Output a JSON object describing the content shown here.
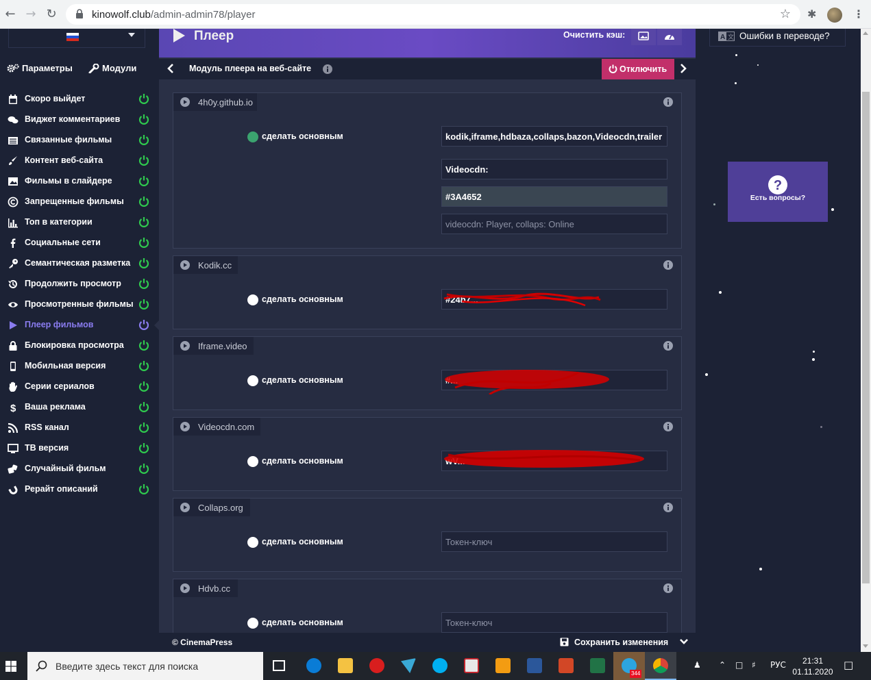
{
  "browser": {
    "url_host": "kinowolf.club",
    "url_path": "/admin-admin78/player"
  },
  "sidebar": {
    "tabs": [
      {
        "label": "Параметры"
      },
      {
        "label": "Модули"
      }
    ],
    "items": [
      {
        "label": "Скоро выйдет",
        "icon": "calendar-icon"
      },
      {
        "label": "Виджет комментариев",
        "icon": "comments-icon"
      },
      {
        "label": "Связанные фильмы",
        "icon": "list-icon"
      },
      {
        "label": "Контент веб-сайта",
        "icon": "brush-icon"
      },
      {
        "label": "Фильмы в слайдере",
        "icon": "images-icon"
      },
      {
        "label": "Запрещенные фильмы",
        "icon": "copyright-icon"
      },
      {
        "label": "Топ в категории",
        "icon": "chart-icon"
      },
      {
        "label": "Социальные сети",
        "icon": "facebook-icon"
      },
      {
        "label": "Семантическая разметка",
        "icon": "key-icon"
      },
      {
        "label": "Продолжить просмотр",
        "icon": "history-icon"
      },
      {
        "label": "Просмотренные фильмы",
        "icon": "eye-icon"
      },
      {
        "label": "Плеер фильмов",
        "icon": "play-icon",
        "active": true
      },
      {
        "label": "Блокировка просмотра",
        "icon": "lock-icon"
      },
      {
        "label": "Мобильная версия",
        "icon": "mobile-icon"
      },
      {
        "label": "Серии сериалов",
        "icon": "hand-icon"
      },
      {
        "label": "Ваша реклама",
        "icon": "dollar-icon"
      },
      {
        "label": "RSS канал",
        "icon": "rss-icon"
      },
      {
        "label": "ТВ версия",
        "icon": "tv-icon"
      },
      {
        "label": "Случайный фильм",
        "icon": "dice-icon"
      },
      {
        "label": "Рерайт описаний",
        "icon": "magnet-icon"
      }
    ]
  },
  "header": {
    "title": "Плеер",
    "cache_label": "Очистить кэш:"
  },
  "subbar": {
    "label": "Модуль плеера на веб-сайте",
    "disable_label": "Отключить"
  },
  "panels": [
    {
      "tab": "4h0y.github.io",
      "radio_label": "сделать основным",
      "selected": true,
      "fields": [
        {
          "value": "kodik,iframe,hdbaza,collaps,bazon,Videocdn,trailer",
          "style": "bold"
        },
        {
          "value": " Videocdn:",
          "style": "bold"
        },
        {
          "value": "#3A4652",
          "style": "light"
        },
        {
          "value": "videocdn: Player, collaps: Online",
          "style": "ph"
        }
      ]
    },
    {
      "tab": "Kodik.cc",
      "radio_label": "сделать основным",
      "selected": false,
      "fields": [
        {
          "value": "#24b7...",
          "style": "redacted"
        }
      ]
    },
    {
      "tab": "Iframe.video",
      "radio_label": "сделать основным",
      "selected": false,
      "fields": [
        {
          "value": "#...",
          "style": "redacted"
        }
      ]
    },
    {
      "tab": "Videocdn.com",
      "radio_label": "сделать основным",
      "selected": false,
      "fields": [
        {
          "value": "wV...",
          "style": "redacted"
        }
      ]
    },
    {
      "tab": "Collaps.org",
      "radio_label": "сделать основным",
      "selected": false,
      "fields": [
        {
          "placeholder": "Токен-ключ",
          "style": "ph"
        }
      ]
    },
    {
      "tab": "Hdvb.cc",
      "radio_label": "сделать основным",
      "selected": false,
      "fields": [
        {
          "placeholder": "Токен-ключ",
          "style": "ph"
        }
      ]
    }
  ],
  "footer": {
    "copyright": "© CinemaPress",
    "save_label": "Сохранить изменения"
  },
  "right": {
    "translate_label": "Ошибки в переводе?",
    "help_label": "Есть вопросы?"
  },
  "taskbar": {
    "search_placeholder": "Введите здесь текст для поиска",
    "telegram_badge": "344",
    "lang": "РУС",
    "time": "21:31",
    "date": "01.11.2020"
  },
  "colors": {
    "accent": "#6a4bc4",
    "power_green": "#2fca4e",
    "disable_red": "#c22f6a",
    "active_item": "#8a7cf0"
  }
}
